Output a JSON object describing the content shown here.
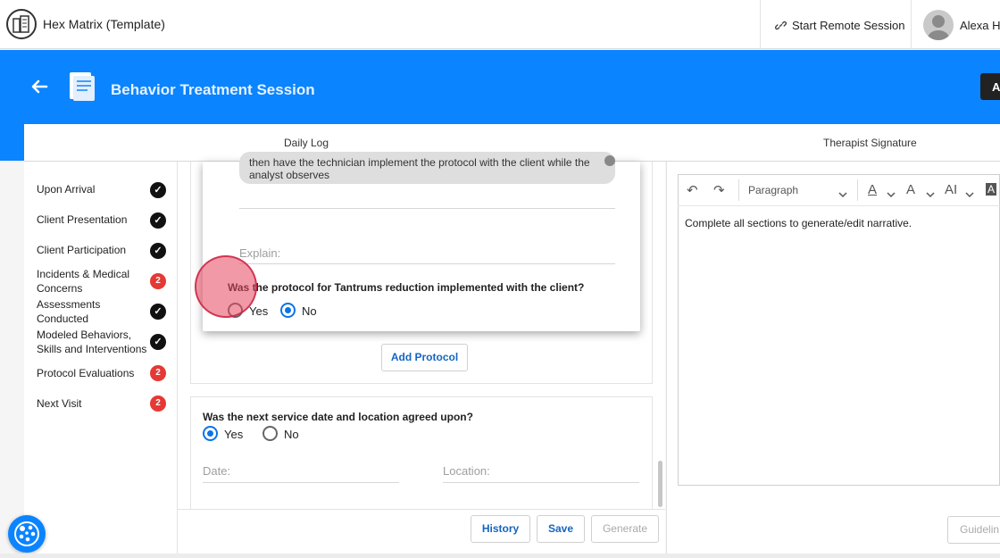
{
  "app": {
    "title": "Hex Matrix (Template)"
  },
  "topbar": {
    "remote_label": "Start Remote Session",
    "user_name": "Alexa He"
  },
  "header": {
    "title": "Behavior Treatment Session",
    "corner_label": "A"
  },
  "tabs": [
    {
      "label": "Daily Log"
    },
    {
      "label": "Therapist Signature"
    }
  ],
  "sidebar": {
    "items": [
      {
        "label": "Upon Arrival",
        "status": "check"
      },
      {
        "label": "Client Presentation",
        "status": "check"
      },
      {
        "label": "Client Participation",
        "status": "check"
      },
      {
        "label": "Incidents & Medical Concerns",
        "status": "2"
      },
      {
        "label": "Assessments Conducted",
        "status": "check"
      },
      {
        "label": "Modeled Behaviors, Skills and Interventions",
        "status": "check"
      },
      {
        "label": "Protocol Evaluations",
        "status": "2"
      },
      {
        "label": "Next Visit",
        "status": "2"
      }
    ],
    "check_glyph": "✓"
  },
  "protocol_modal": {
    "chip_text": "then have the technician implement the protocol with the client while the analyst observes",
    "explain_placeholder": "Explain:",
    "question": "Was the protocol for Tantrums reduction implemented with the client?",
    "options": [
      {
        "label": "Yes",
        "selected": false
      },
      {
        "label": "No",
        "selected": true
      }
    ]
  },
  "add_protocol_label": "Add Protocol",
  "next_visit": {
    "question": "Was the next service date and location agreed upon?",
    "options": [
      {
        "label": "Yes",
        "selected": true
      },
      {
        "label": "No",
        "selected": false
      }
    ],
    "date_placeholder": "Date:",
    "location_placeholder": "Location:"
  },
  "footer": {
    "history": "History",
    "save": "Save",
    "generate": "Generate",
    "guideline": "Guidelin"
  },
  "editor": {
    "paragraph_select": "Paragraph",
    "narrative": "Complete all sections to generate/edit narrative.",
    "toolbar_glyphs": {
      "undo": "↶",
      "redo": "↷",
      "font_color": "A",
      "font_size": "A",
      "text_size": "AI",
      "highlight": "A"
    }
  },
  "colors": {
    "primary_blue": "#0a84ff",
    "badge_red": "#e53935",
    "link_blue": "#1565c0"
  }
}
